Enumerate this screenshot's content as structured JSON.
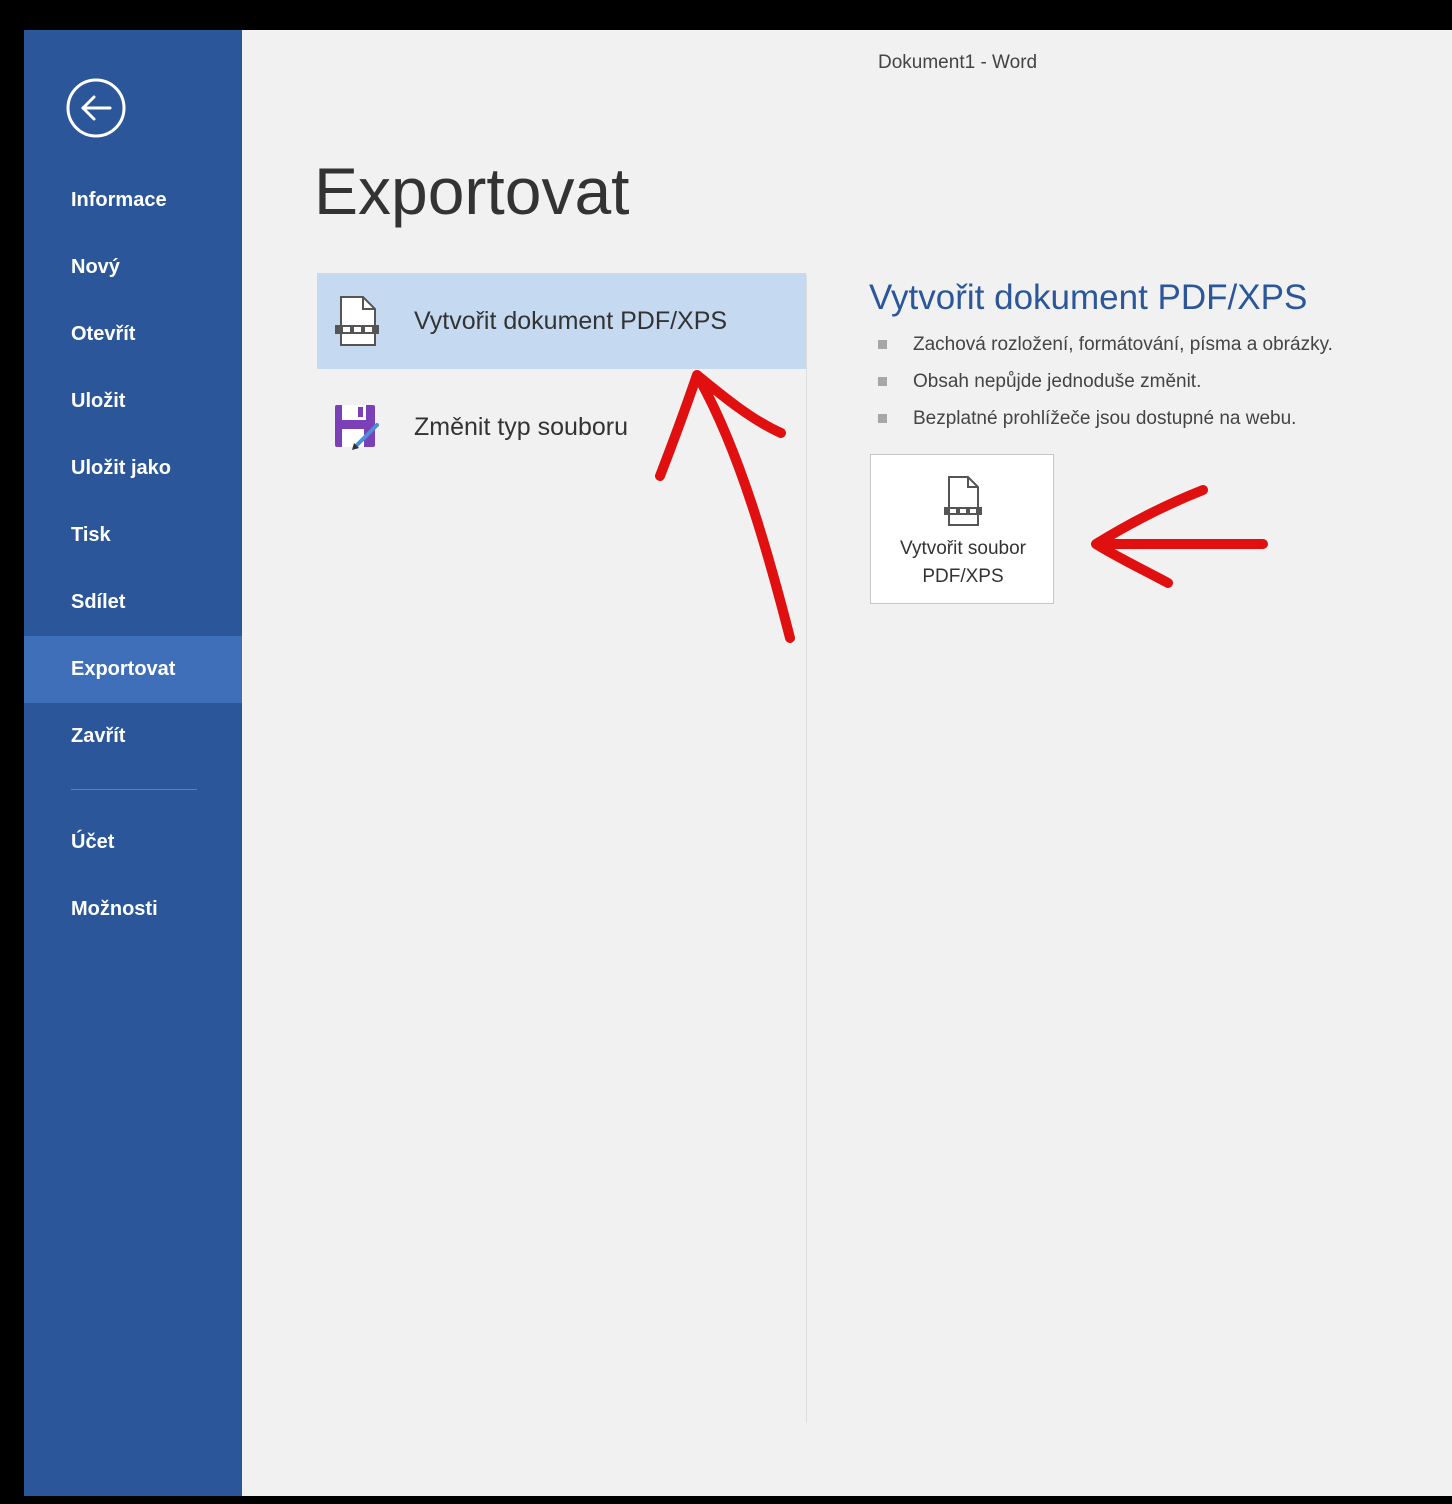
{
  "window": {
    "title": "Dokument1 - Word"
  },
  "sidebar": {
    "back_icon": "back-arrow-circle-icon",
    "items": [
      {
        "label": "Informace"
      },
      {
        "label": "Nový"
      },
      {
        "label": "Otevřít"
      },
      {
        "label": "Uložit"
      },
      {
        "label": "Uložit jako"
      },
      {
        "label": "Tisk"
      },
      {
        "label": "Sdílet"
      },
      {
        "label": "Exportovat",
        "active": true
      },
      {
        "label": "Zavřít"
      }
    ],
    "footer_items": [
      {
        "label": "Účet"
      },
      {
        "label": "Možnosti"
      }
    ]
  },
  "main": {
    "page_title": "Exportovat",
    "options": [
      {
        "label": "Vytvořit dokument PDF/XPS",
        "icon": "pdf-document-icon",
        "selected": true
      },
      {
        "label": "Změnit typ souboru",
        "icon": "save-as-floppy-icon",
        "selected": false
      }
    ],
    "detail": {
      "title": "Vytvořit dokument PDF/XPS",
      "bullets": [
        "Zachová rozložení, formátování, písma a obrázky.",
        "Obsah nepůjde jednoduše změnit.",
        "Bezplatné prohlížeče jsou dostupné na webu."
      ],
      "button": {
        "line1": "Vytvořit soubor",
        "line2": "PDF/XPS",
        "icon": "pdf-document-icon"
      }
    }
  },
  "colors": {
    "sidebar_bg": "#2b579a",
    "sidebar_active": "#3f6fb8",
    "accent_text": "#2b579a",
    "selected_option_bg": "#c5d9f1",
    "annotation_red": "#e01010"
  }
}
